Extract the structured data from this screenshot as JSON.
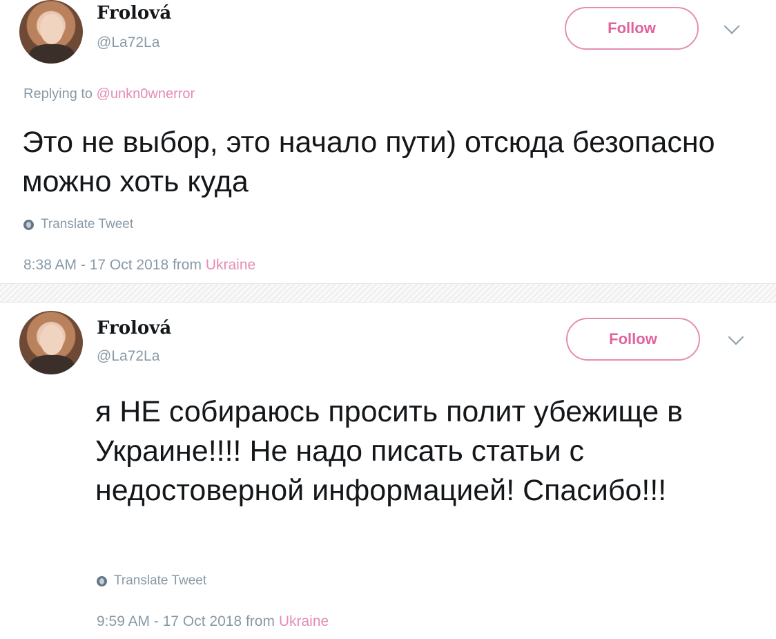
{
  "tweets": [
    {
      "author_name": "Frolová",
      "author_handle": "@La72La",
      "follow_label": "Follow",
      "replying_prefix": "Replying to",
      "replying_to": "@unkn0wnerror",
      "text": "Это не выбор, это начало пути) отсюда безопасно можно хоть куда",
      "translate_label": "Translate Tweet",
      "timestamp": "8:38 AM - 17 Oct 2018 from",
      "location": "Ukraine"
    },
    {
      "author_name": "Frolová",
      "author_handle": "@La72La",
      "follow_label": "Follow",
      "text": "я НЕ собираюсь просить полит убежище в Украине!!!! Не надо писать статьи с недостоверной информацией! Спасибо!!!",
      "translate_label": "Translate Tweet",
      "timestamp": "9:59 AM - 17 Oct 2018 from",
      "location": "Ukraine"
    }
  ],
  "icons": {
    "avatar": "avatar",
    "follow": "follow-button",
    "menu": "chevron-down-icon",
    "translate": "globe-icon"
  },
  "colors": {
    "accent": "#e58cb3",
    "muted": "#8899a6",
    "text": "#14171a"
  }
}
